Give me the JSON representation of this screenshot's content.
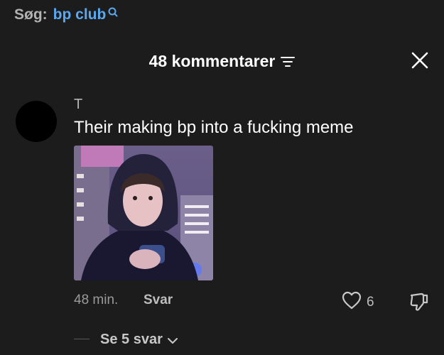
{
  "search": {
    "label": "Søg:",
    "query": "bp club",
    "icon": "search-icon"
  },
  "header": {
    "title": "48 kommentarer",
    "filter_icon": "filter-icon",
    "close_icon": "close-icon"
  },
  "comment": {
    "author": "T",
    "text": "Their making bp into a fucking meme",
    "time": "48 min.",
    "reply_label": "Svar",
    "like_count": "6",
    "view_replies": "Se 5 svar"
  },
  "colors": {
    "background": "#1c1c1c",
    "link": "#5aa9f0",
    "muted": "#9a9a9a"
  }
}
